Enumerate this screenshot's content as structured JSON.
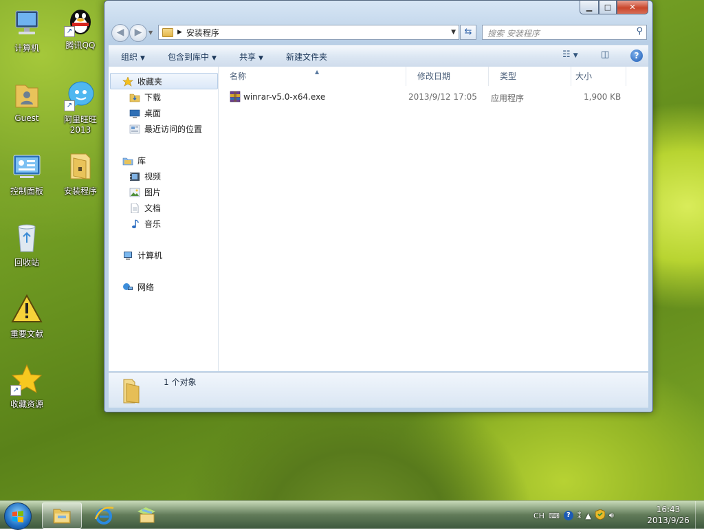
{
  "desktop": {
    "icons": [
      {
        "label": "计算机",
        "icon": "computer-icon"
      },
      {
        "label": "腾讯QQ",
        "icon": "qq-penguin-icon"
      },
      {
        "label": "Guest",
        "icon": "user-folder-icon"
      },
      {
        "label": "阿里旺旺",
        "label2": "2013",
        "icon": "aliwangwang-icon"
      },
      {
        "label": "控制面板",
        "icon": "control-panel-icon"
      },
      {
        "label": "安装程序",
        "icon": "folder-icon"
      },
      {
        "label": "回收站",
        "icon": "recycle-bin-icon"
      },
      {
        "label": "重要文献",
        "icon": "warning-icon"
      },
      {
        "label": "收藏资源",
        "icon": "star-icon"
      }
    ]
  },
  "window": {
    "caption": {
      "minimize": "minimize-icon",
      "maximize": "maximize-icon",
      "close": "close-icon"
    },
    "address": {
      "path": "安装程序"
    },
    "search": {
      "placeholder": "搜索 安装程序"
    },
    "toolbar": {
      "organize": "组织",
      "include_library": "包含到库中",
      "share": "共享",
      "new_folder": "新建文件夹"
    },
    "nav": {
      "favorites": "收藏夹",
      "downloads": "下载",
      "desktop": "桌面",
      "recent": "最近访问的位置",
      "libraries": "库",
      "videos": "视频",
      "pictures": "图片",
      "documents": "文档",
      "music": "音乐",
      "computer": "计算机",
      "network": "网络"
    },
    "columns": {
      "name": "名称",
      "modified": "修改日期",
      "type": "类型",
      "size": "大小"
    },
    "files": [
      {
        "name": "winrar-v5.0-x64.exe",
        "modified": "2013/9/12 17:05",
        "type": "应用程序",
        "size": "1,900 KB"
      }
    ],
    "status": {
      "count": "1 个对象"
    }
  },
  "taskbar": {
    "apps": [
      "file-explorer-icon",
      "internet-explorer-icon",
      "folders-icon"
    ],
    "tray": {
      "lang": "CH"
    },
    "clock": {
      "time": "16:43",
      "date": "2013/9/26"
    }
  },
  "colors": {
    "accent": "#1c5bb5",
    "close": "#c9462c"
  }
}
